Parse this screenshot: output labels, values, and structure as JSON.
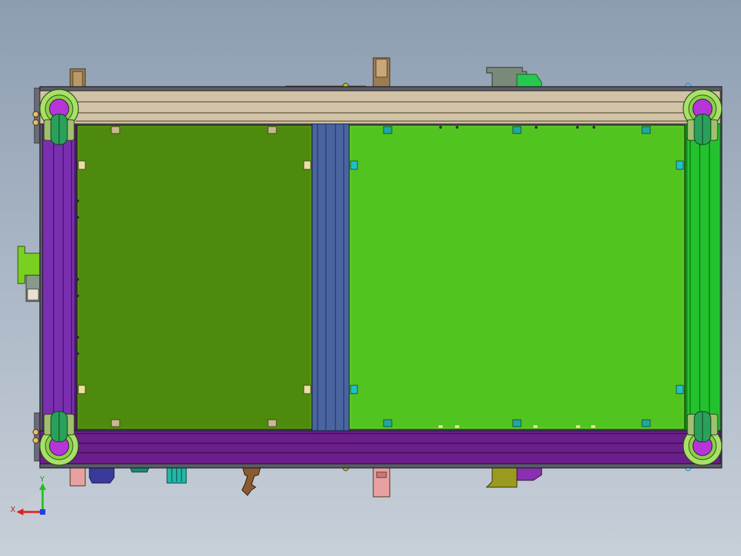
{
  "viewport": {
    "name": "cad-3d-viewport",
    "view": "top-view",
    "model": "frame-assembly"
  },
  "colors": {
    "background_top": "#8d9db1",
    "background_bottom": "#c7cfd8",
    "top_rail": "#d2c3a6",
    "bottom_rail": "#6b1f8a",
    "left_rail": "#7a2fb0",
    "right_rail": "#22c22e",
    "left_panel": "#4e8a0e",
    "right_panel": "#52c41f",
    "center_divider": "#4a64a0",
    "caster_ring": "#a8e06a",
    "caster_hub": "#b535d8",
    "caster_wheel": "#2aa05a"
  },
  "triad": {
    "x_label": "X",
    "y_label": "Y",
    "x_color": "#e02020",
    "y_color": "#20c020",
    "z_color": "#2040e0"
  },
  "icons": [
    "view-triad-icon",
    "caster-wheel-icon",
    "mounting-bolt-icon",
    "bracket-icon"
  ]
}
